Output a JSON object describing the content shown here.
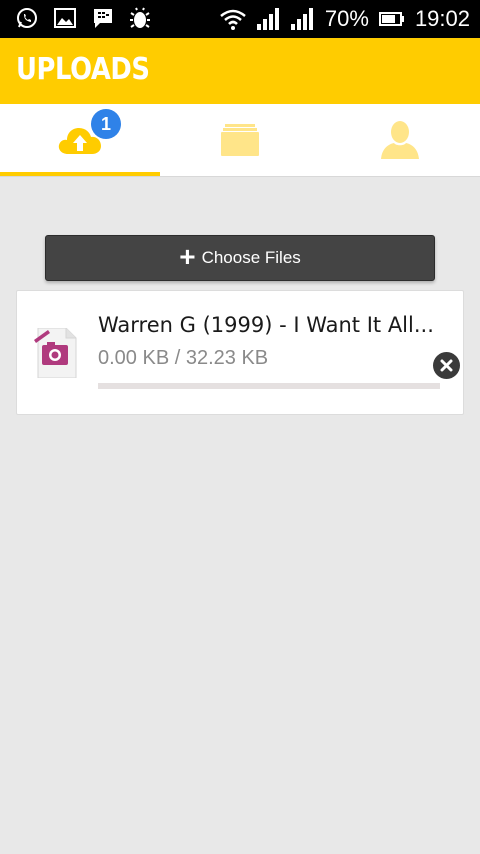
{
  "status_bar": {
    "battery": "70%",
    "time": "19:02",
    "icons": [
      "whatsapp-icon",
      "gallery-icon",
      "bbm-icon",
      "debug-icon",
      "wifi-icon",
      "signal-icon",
      "signal-icon",
      "battery-icon"
    ]
  },
  "app_bar": {
    "title": "UPLOADS"
  },
  "tabs": [
    {
      "icon": "cloud-upload-icon",
      "badge": "1",
      "active": true
    },
    {
      "icon": "folder-icon",
      "active": false
    },
    {
      "icon": "person-icon",
      "active": false
    }
  ],
  "choose_button": {
    "label": "Choose Files",
    "icon": "plus-icon"
  },
  "upload": {
    "file_name": "Warren G (1999) - I Want It All...",
    "size_text": "0.00 KB / 32.23 KB",
    "progress": 0,
    "file_icon": "image-file-icon",
    "cancel_icon": "close-icon"
  },
  "colors": {
    "accent": "#ffcc00",
    "badge": "#2f82e8",
    "button": "#444444",
    "background": "#e8e8e8"
  }
}
